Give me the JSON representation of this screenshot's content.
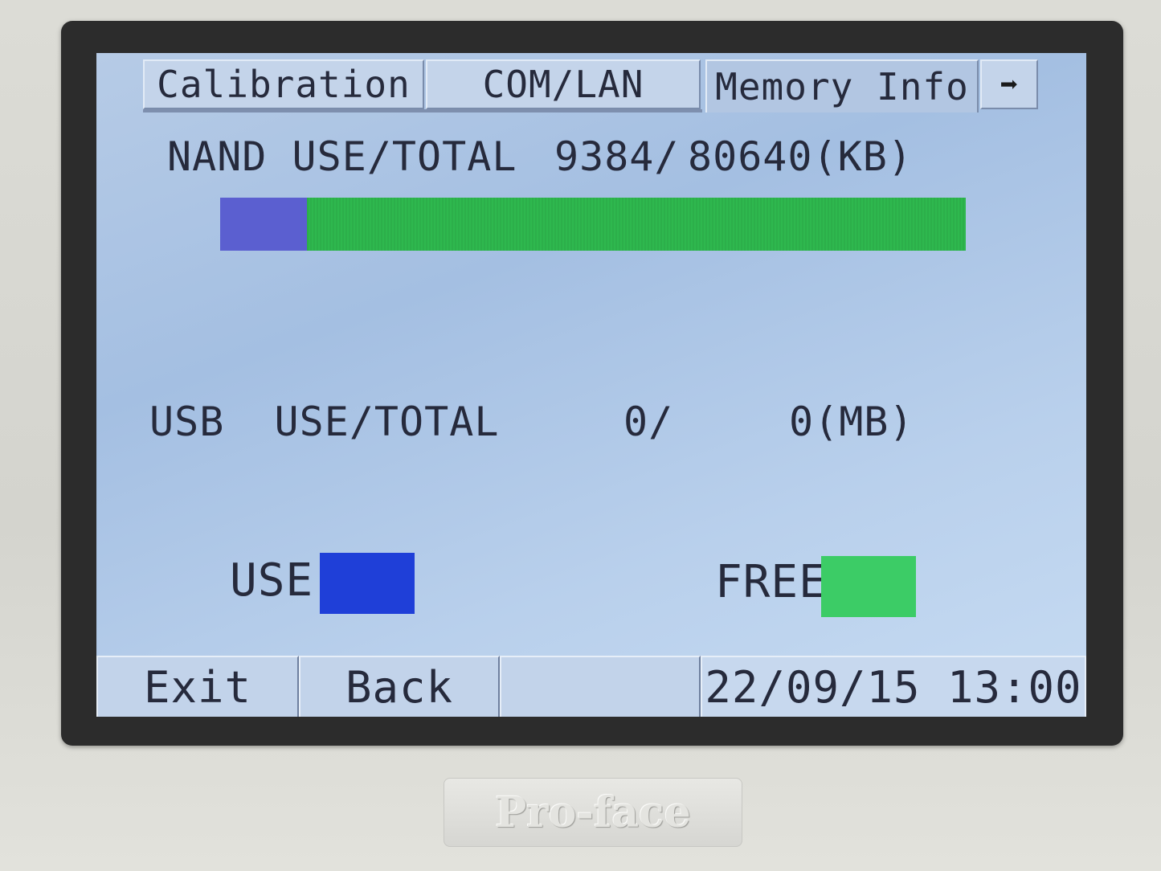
{
  "tabs": [
    {
      "label": "Calibration"
    },
    {
      "label": "COM/LAN"
    },
    {
      "label": "Memory Info",
      "active": true
    },
    {
      "icon": "arrow-right-icon",
      "glyph": "➡"
    }
  ],
  "nand": {
    "label": "NAND USE/TOTAL",
    "used": "9384/",
    "total": "80640(KB)",
    "used_fraction": 0.116
  },
  "usb": {
    "label": "USB  USE/TOTAL",
    "used": "0/",
    "total": "0(MB)"
  },
  "legend": {
    "use_label": "USE",
    "free_label": "FREE",
    "use_color": "#1f3fd8",
    "free_color": "#3ccc66"
  },
  "footer": {
    "exit_label": "Exit",
    "back_label": "Back",
    "datetime": "22/09/15 13:00"
  },
  "device": {
    "brand": "Pro-face"
  }
}
